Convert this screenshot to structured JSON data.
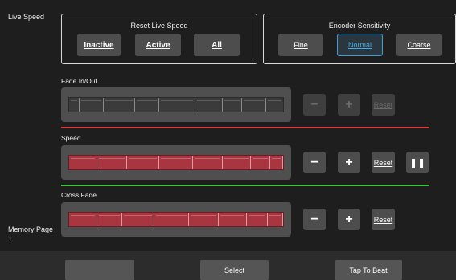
{
  "sidebar": {
    "live_speed_label": "Live Speed",
    "memory_page_label": "Memory Page",
    "memory_page_number": "1"
  },
  "reset_live_speed": {
    "title": "Reset Live Speed",
    "buttons": [
      "Inactive",
      "Active",
      "All"
    ]
  },
  "encoder_sensitivity": {
    "title": "Encoder Sensitivity",
    "buttons": [
      "Fine",
      "Normal",
      "Coarse"
    ],
    "selected": "Normal"
  },
  "fade_in_out": {
    "label": "Fade In/Out",
    "minus": "−",
    "plus": "+",
    "reset": "Reset",
    "enabled": false,
    "divider_color": "#d83b3b"
  },
  "speed": {
    "label": "Speed",
    "minus": "−",
    "plus": "+",
    "reset": "Reset",
    "pause": "❚❚",
    "enabled": true,
    "divider_color": "#3fc43f"
  },
  "cross_fade": {
    "label": "Cross Fade",
    "minus": "−",
    "plus": "+",
    "reset": "Reset",
    "enabled": true
  },
  "softkeys": [
    "",
    "Select",
    "Tap To Beat"
  ],
  "colors": {
    "fader_active": "#a83540",
    "selected_accent": "#3aa0d8"
  }
}
